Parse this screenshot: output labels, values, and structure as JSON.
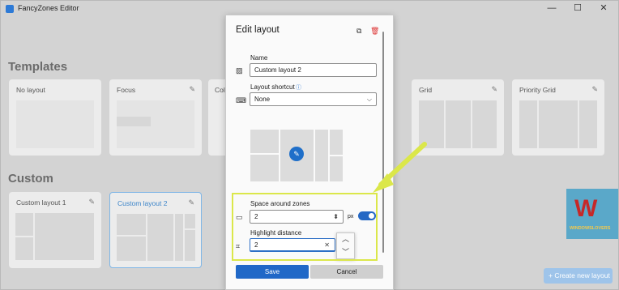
{
  "app": {
    "title": "FancyZones Editor"
  },
  "window_controls": {
    "minimize": "—",
    "maximize": "☐",
    "close": "✕"
  },
  "templates": {
    "title": "Templates",
    "cards": [
      {
        "name": "No layout",
        "editable": false
      },
      {
        "name": "Focus",
        "editable": true
      },
      {
        "name": "Col",
        "editable": false
      },
      {
        "name": "Grid",
        "editable": true
      },
      {
        "name": "Priority Grid",
        "editable": true
      }
    ]
  },
  "custom": {
    "title": "Custom",
    "cards": [
      {
        "name": "Custom layout 1",
        "selected": false
      },
      {
        "name": "Custom layout 2",
        "selected": true
      }
    ]
  },
  "create_button": "+ Create new layout",
  "logo": {
    "letter": "W",
    "text": "WINDOWSLOVERS"
  },
  "dialog": {
    "title": "Edit layout",
    "name_label": "Name",
    "name_value": "Custom layout 2",
    "shortcut_label": "Layout shortcut",
    "shortcut_value": "None",
    "space_label": "Space around zones",
    "space_value": "2",
    "space_unit": "px",
    "space_enabled": true,
    "highlight_label": "Highlight distance",
    "highlight_value": "2",
    "save_label": "Save",
    "cancel_label": "Cancel"
  },
  "colors": {
    "accent": "#2068c7",
    "highlight": "#dbe74a",
    "arrow": "#dbe74a"
  }
}
